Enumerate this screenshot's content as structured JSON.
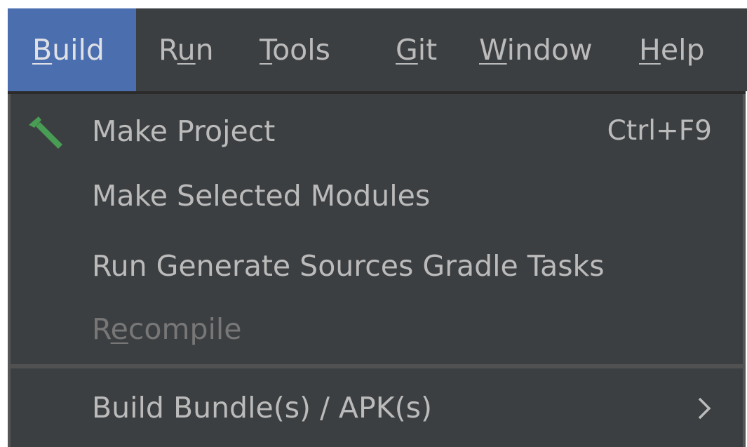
{
  "menubar": {
    "items": [
      {
        "mnemonic": "B",
        "rest": "uild",
        "active": true
      },
      {
        "pre": "R",
        "mnemonic": "u",
        "rest": "n"
      },
      {
        "mnemonic": "T",
        "rest": "ools"
      },
      {
        "mnemonic": "G",
        "rest": "it"
      },
      {
        "mnemonic": "W",
        "rest": "indow"
      },
      {
        "mnemonic": "H",
        "rest": "elp"
      }
    ]
  },
  "dropdown": {
    "items": [
      {
        "label": "Make Project",
        "shortcut": "Ctrl+F9",
        "icon": "hammer-icon",
        "enabled": true
      },
      {
        "label": "Make Selected Modules",
        "enabled": true
      },
      {
        "label": "Run Generate Sources Gradle Tasks",
        "enabled": true
      },
      {
        "label_pre": "R",
        "label_mnemonic": "e",
        "label_rest": "compile",
        "enabled": false
      },
      {
        "label": "Build Bundle(s) / APK(s)",
        "submenu": true,
        "enabled": true
      }
    ]
  },
  "colors": {
    "menubar_bg": "#3c3f41",
    "active_bg": "#4b6eaf",
    "text": "#bbbbbb",
    "disabled_text": "#777777",
    "hammer_green": "#499c54"
  }
}
